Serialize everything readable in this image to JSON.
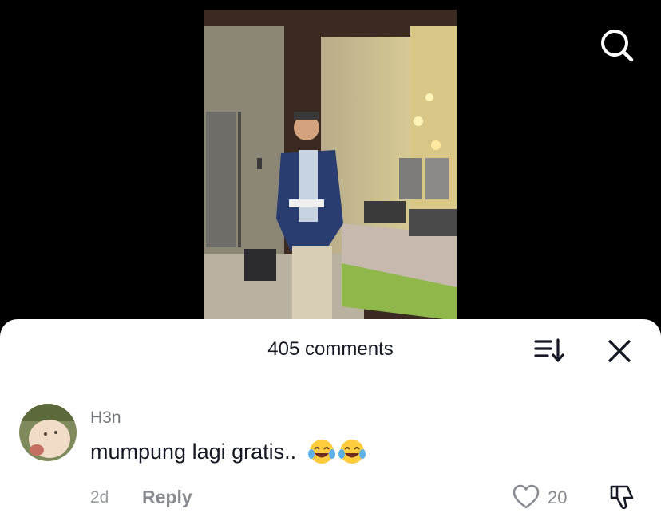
{
  "video": {
    "icons": {
      "search": "search-icon"
    }
  },
  "comments_panel": {
    "count_label": "405 comments",
    "icons": {
      "sort": "sort-icon",
      "close": "close-icon"
    }
  },
  "comment": {
    "username": "H3n",
    "text": "mumpung lagi gratis..",
    "emojis": [
      "face-with-tears-of-joy",
      "face-with-tears-of-joy"
    ],
    "time": "2d",
    "reply_label": "Reply",
    "like_count": "20",
    "icons": {
      "like": "heart-outline-icon",
      "dislike": "thumbs-down-icon"
    }
  },
  "colors": {
    "text_primary": "#161823",
    "text_secondary": "#8a8b91",
    "sheet_background": "#ffffff",
    "video_background": "#000000"
  }
}
